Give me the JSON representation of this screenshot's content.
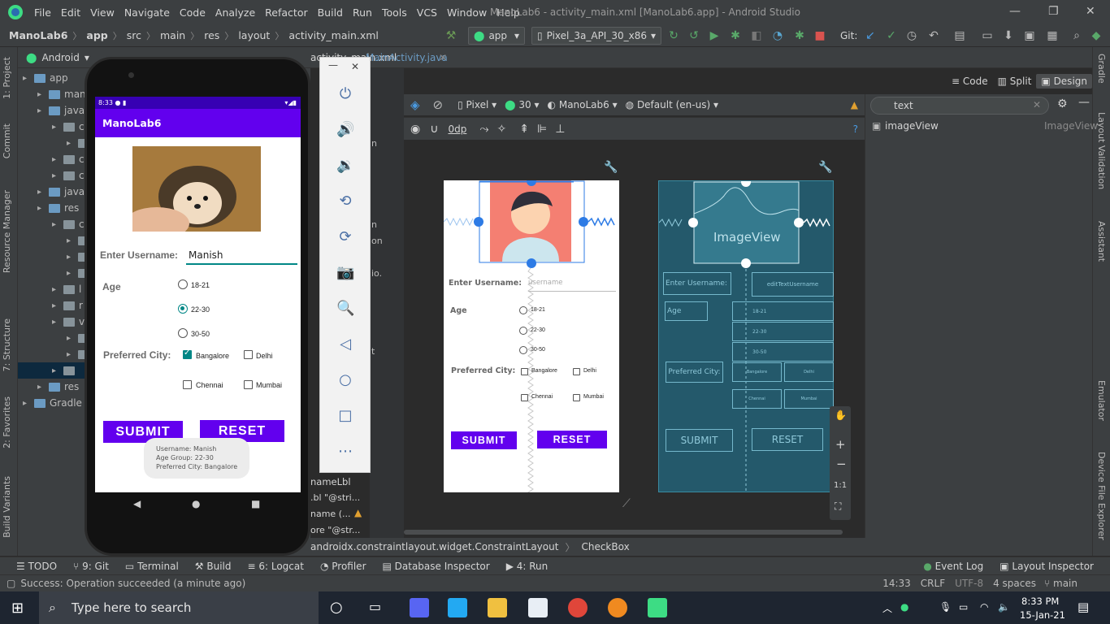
{
  "window": {
    "menu": [
      "File",
      "Edit",
      "View",
      "Navigate",
      "Code",
      "Analyze",
      "Refactor",
      "Build",
      "Run",
      "Tools",
      "VCS",
      "Window",
      "Help"
    ],
    "title": "ManoLab6 - activity_main.xml [ManoLab6.app] - Android Studio"
  },
  "toolbar": {
    "breadcrumbs": [
      "ManoLab6",
      "app",
      "src",
      "main",
      "res",
      "layout",
      "activity_main.xml"
    ],
    "run_config": "app",
    "device": "Pixel_3a_API_30_x86",
    "git_label": "Git:"
  },
  "project_panel": {
    "view_mode": "Android",
    "tree": [
      {
        "label": "app",
        "indent": 0
      },
      {
        "label": "man",
        "indent": 1
      },
      {
        "label": "java",
        "indent": 1
      },
      {
        "label": "c",
        "indent": 2
      },
      {
        "label": "",
        "indent": 3
      },
      {
        "label": "c",
        "indent": 2
      },
      {
        "label": "c",
        "indent": 2
      },
      {
        "label": "java",
        "indent": 1
      },
      {
        "label": "res",
        "indent": 1
      },
      {
        "label": "c",
        "indent": 2
      },
      {
        "label": "[",
        "indent": 3
      },
      {
        "label": "",
        "indent": 3
      },
      {
        "label": "",
        "indent": 3
      },
      {
        "label": "l",
        "indent": 2
      },
      {
        "label": "r",
        "indent": 2
      },
      {
        "label": "v",
        "indent": 2
      },
      {
        "label": "",
        "indent": 3
      },
      {
        "label": "",
        "indent": 3
      },
      {
        "label": "",
        "indent": 2
      },
      {
        "label": "res",
        "indent": 1
      },
      {
        "label": "Gradle S",
        "indent": 0
      }
    ]
  },
  "left_tabs": [
    "1: Project",
    "Commit",
    "Resource Manager",
    "7: Structure",
    "2: Favorites",
    "Build Variants"
  ],
  "right_tabs": [
    "Gradle",
    "Layout Validation",
    "Assistant",
    "Emulator",
    "Device File Explorer"
  ],
  "editor_tabs": [
    "activity_main.xml",
    "MainActivity.java"
  ],
  "design_toolbar": {
    "device": "Pixel",
    "api": "30",
    "theme": "ManoLab6",
    "locale": "Default (en-us)",
    "margin": "0dp"
  },
  "view_modes": [
    "Code",
    "Split",
    "Design"
  ],
  "attributes": {
    "search": "text",
    "item_label": "imageView",
    "item_type": "ImageView"
  },
  "mid_snippets": [
    "n",
    "n",
    "on",
    "io.",
    "t",
    "nameLbl",
    ".bl  \"@stri...",
    "name  (...",
    "ore  \"@str..."
  ],
  "component_path": [
    "androidx.constraintlayout.widget.ConstraintLayout",
    "CheckBox"
  ],
  "phone": {
    "time": "8:33",
    "app_title": "ManoLab6",
    "username_label": "Enter Username:",
    "username_value": "Manish",
    "age_label": "Age",
    "age_options": [
      "18-21",
      "22-30",
      "30-50"
    ],
    "age_selected": "22-30",
    "city_label": "Preferred City:",
    "cities": [
      "Bangalore",
      "Delhi",
      "Chennai",
      "Mumbai"
    ],
    "city_checked": [
      "Bangalore"
    ],
    "submit_label": "SUBMIT",
    "reset_label": "RESET",
    "toast": [
      "Username: Manish",
      "Age Group: 22-30",
      "Preferred City: Bangalore"
    ]
  },
  "design_preview": {
    "username_label": "Enter Username:",
    "username_hint": "username",
    "age_label": "Age",
    "age_options": [
      "18-21",
      "22-30",
      "30-50"
    ],
    "city_label": "Preferred City:",
    "cities": [
      "Bangalore",
      "Delhi",
      "Chennai",
      "Mumbai"
    ],
    "submit_label": "SUBMIT",
    "reset_label": "RESET"
  },
  "blueprint": {
    "imageview": "ImageView",
    "username_label": "Enter Username:",
    "edittext": "editTextUsername",
    "age_label": "Age",
    "age_options": [
      "18-21",
      "22-30",
      "30-50"
    ],
    "city_label": "Preferred City:",
    "cities": [
      "Bangalore",
      "Delhi",
      "Chennai",
      "Mumbai"
    ],
    "submit_label": "SUBMIT",
    "reset_label": "RESET"
  },
  "zoom_controls": [
    "+",
    "−",
    "1:1"
  ],
  "bottom_tools": [
    "TODO",
    "9: Git",
    "Terminal",
    "Build",
    "6: Logcat",
    "Profiler",
    "Database Inspector",
    "4: Run",
    "Event Log",
    "Layout Inspector"
  ],
  "status": {
    "message": "Success: Operation succeeded (a minute ago)",
    "position": "14:33",
    "line_sep": "CRLF",
    "encoding": "UTF-8",
    "indent": "4 spaces",
    "branch": "main"
  },
  "taskbar": {
    "search_placeholder": "Type here to search",
    "time": "8:33 PM",
    "date": "15-Jan-21"
  },
  "colors": {
    "ide_bg": "#3c3f41",
    "accent_purple": "#6200ee",
    "teal": "#018786",
    "blueprint": "#24596b"
  }
}
